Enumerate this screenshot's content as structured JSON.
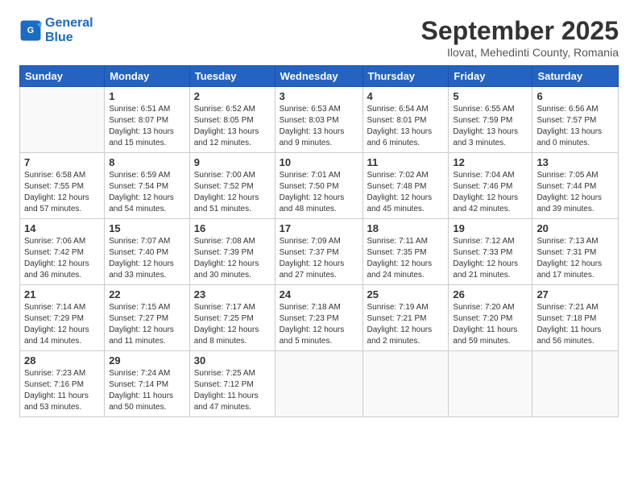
{
  "logo": {
    "line1": "General",
    "line2": "Blue"
  },
  "header": {
    "title": "September 2025",
    "subtitle": "Ilovat, Mehedinti County, Romania"
  },
  "weekdays": [
    "Sunday",
    "Monday",
    "Tuesday",
    "Wednesday",
    "Thursday",
    "Friday",
    "Saturday"
  ],
  "weeks": [
    [
      {
        "day": "",
        "info": ""
      },
      {
        "day": "1",
        "info": "Sunrise: 6:51 AM\nSunset: 8:07 PM\nDaylight: 13 hours\nand 15 minutes."
      },
      {
        "day": "2",
        "info": "Sunrise: 6:52 AM\nSunset: 8:05 PM\nDaylight: 13 hours\nand 12 minutes."
      },
      {
        "day": "3",
        "info": "Sunrise: 6:53 AM\nSunset: 8:03 PM\nDaylight: 13 hours\nand 9 minutes."
      },
      {
        "day": "4",
        "info": "Sunrise: 6:54 AM\nSunset: 8:01 PM\nDaylight: 13 hours\nand 6 minutes."
      },
      {
        "day": "5",
        "info": "Sunrise: 6:55 AM\nSunset: 7:59 PM\nDaylight: 13 hours\nand 3 minutes."
      },
      {
        "day": "6",
        "info": "Sunrise: 6:56 AM\nSunset: 7:57 PM\nDaylight: 13 hours\nand 0 minutes."
      }
    ],
    [
      {
        "day": "7",
        "info": "Sunrise: 6:58 AM\nSunset: 7:55 PM\nDaylight: 12 hours\nand 57 minutes."
      },
      {
        "day": "8",
        "info": "Sunrise: 6:59 AM\nSunset: 7:54 PM\nDaylight: 12 hours\nand 54 minutes."
      },
      {
        "day": "9",
        "info": "Sunrise: 7:00 AM\nSunset: 7:52 PM\nDaylight: 12 hours\nand 51 minutes."
      },
      {
        "day": "10",
        "info": "Sunrise: 7:01 AM\nSunset: 7:50 PM\nDaylight: 12 hours\nand 48 minutes."
      },
      {
        "day": "11",
        "info": "Sunrise: 7:02 AM\nSunset: 7:48 PM\nDaylight: 12 hours\nand 45 minutes."
      },
      {
        "day": "12",
        "info": "Sunrise: 7:04 AM\nSunset: 7:46 PM\nDaylight: 12 hours\nand 42 minutes."
      },
      {
        "day": "13",
        "info": "Sunrise: 7:05 AM\nSunset: 7:44 PM\nDaylight: 12 hours\nand 39 minutes."
      }
    ],
    [
      {
        "day": "14",
        "info": "Sunrise: 7:06 AM\nSunset: 7:42 PM\nDaylight: 12 hours\nand 36 minutes."
      },
      {
        "day": "15",
        "info": "Sunrise: 7:07 AM\nSunset: 7:40 PM\nDaylight: 12 hours\nand 33 minutes."
      },
      {
        "day": "16",
        "info": "Sunrise: 7:08 AM\nSunset: 7:39 PM\nDaylight: 12 hours\nand 30 minutes."
      },
      {
        "day": "17",
        "info": "Sunrise: 7:09 AM\nSunset: 7:37 PM\nDaylight: 12 hours\nand 27 minutes."
      },
      {
        "day": "18",
        "info": "Sunrise: 7:11 AM\nSunset: 7:35 PM\nDaylight: 12 hours\nand 24 minutes."
      },
      {
        "day": "19",
        "info": "Sunrise: 7:12 AM\nSunset: 7:33 PM\nDaylight: 12 hours\nand 21 minutes."
      },
      {
        "day": "20",
        "info": "Sunrise: 7:13 AM\nSunset: 7:31 PM\nDaylight: 12 hours\nand 17 minutes."
      }
    ],
    [
      {
        "day": "21",
        "info": "Sunrise: 7:14 AM\nSunset: 7:29 PM\nDaylight: 12 hours\nand 14 minutes."
      },
      {
        "day": "22",
        "info": "Sunrise: 7:15 AM\nSunset: 7:27 PM\nDaylight: 12 hours\nand 11 minutes."
      },
      {
        "day": "23",
        "info": "Sunrise: 7:17 AM\nSunset: 7:25 PM\nDaylight: 12 hours\nand 8 minutes."
      },
      {
        "day": "24",
        "info": "Sunrise: 7:18 AM\nSunset: 7:23 PM\nDaylight: 12 hours\nand 5 minutes."
      },
      {
        "day": "25",
        "info": "Sunrise: 7:19 AM\nSunset: 7:21 PM\nDaylight: 12 hours\nand 2 minutes."
      },
      {
        "day": "26",
        "info": "Sunrise: 7:20 AM\nSunset: 7:20 PM\nDaylight: 11 hours\nand 59 minutes."
      },
      {
        "day": "27",
        "info": "Sunrise: 7:21 AM\nSunset: 7:18 PM\nDaylight: 11 hours\nand 56 minutes."
      }
    ],
    [
      {
        "day": "28",
        "info": "Sunrise: 7:23 AM\nSunset: 7:16 PM\nDaylight: 11 hours\nand 53 minutes."
      },
      {
        "day": "29",
        "info": "Sunrise: 7:24 AM\nSunset: 7:14 PM\nDaylight: 11 hours\nand 50 minutes."
      },
      {
        "day": "30",
        "info": "Sunrise: 7:25 AM\nSunset: 7:12 PM\nDaylight: 11 hours\nand 47 minutes."
      },
      {
        "day": "",
        "info": ""
      },
      {
        "day": "",
        "info": ""
      },
      {
        "day": "",
        "info": ""
      },
      {
        "day": "",
        "info": ""
      }
    ]
  ]
}
